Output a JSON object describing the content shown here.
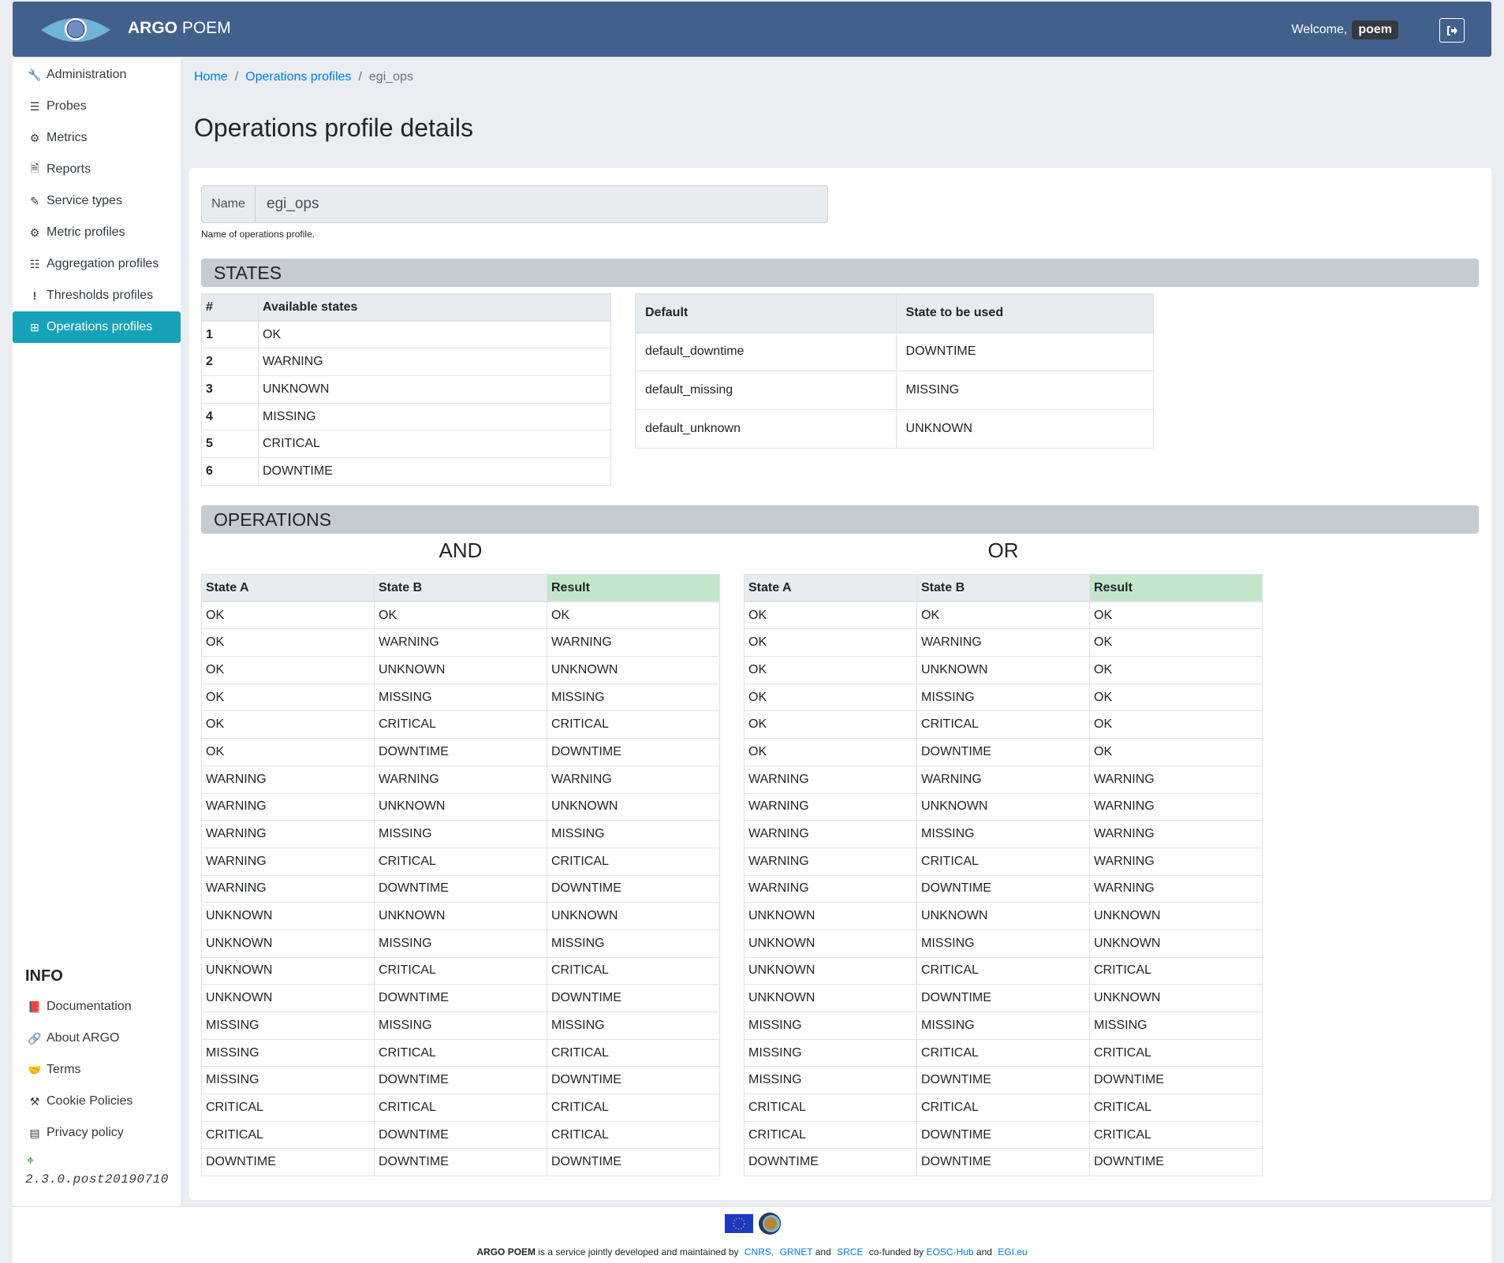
{
  "header": {
    "brand_bold": "ARGO",
    "brand_rest": "POEM",
    "welcome": "Welcome,",
    "username": "poem",
    "logout_icon": "sign-out-icon"
  },
  "sidebar": {
    "items": [
      {
        "label": "Administration",
        "icon": "wrench-icon"
      },
      {
        "label": "Probes",
        "icon": "server-icon"
      },
      {
        "label": "Metrics",
        "icon": "cog-icon"
      },
      {
        "label": "Reports",
        "icon": "file-icon"
      },
      {
        "label": "Service types",
        "icon": "highlighter-icon"
      },
      {
        "label": "Metric profiles",
        "icon": "cogs-icon"
      },
      {
        "label": "Aggregation profiles",
        "icon": "tasks-icon"
      },
      {
        "label": "Thresholds profiles",
        "icon": "exclamation-icon"
      },
      {
        "label": "Operations profiles",
        "icon": "table-icon",
        "active": true
      }
    ],
    "info_title": "INFO",
    "info_items": [
      {
        "label": "Documentation",
        "icon": "book-icon"
      },
      {
        "label": "About ARGO",
        "icon": "link-icon"
      },
      {
        "label": "Terms",
        "icon": "handshake-icon"
      },
      {
        "label": "Cookie Policies",
        "icon": "gavel-icon"
      },
      {
        "label": "Privacy policy",
        "icon": "id-card-icon"
      }
    ],
    "version": "2.3.0.post20190710"
  },
  "breadcrumb": [
    "Home",
    "Operations profiles",
    "egi_ops"
  ],
  "page_title": "Operations profile details",
  "form": {
    "name_label": "Name",
    "name_value": "egi_ops",
    "name_help": "Name of operations profile."
  },
  "states_section": {
    "title": "STATES",
    "available": {
      "headers": [
        "#",
        "Available states"
      ],
      "rows": [
        [
          "1",
          "OK"
        ],
        [
          "2",
          "WARNING"
        ],
        [
          "3",
          "UNKNOWN"
        ],
        [
          "4",
          "MISSING"
        ],
        [
          "5",
          "CRITICAL"
        ],
        [
          "6",
          "DOWNTIME"
        ]
      ]
    },
    "defaults": {
      "headers": [
        "Default",
        "State to be used"
      ],
      "rows": [
        [
          "default_downtime",
          "DOWNTIME"
        ],
        [
          "default_missing",
          "MISSING"
        ],
        [
          "default_unknown",
          "UNKNOWN"
        ]
      ]
    }
  },
  "operations_section": {
    "title": "OPERATIONS",
    "operations": [
      {
        "name": "AND",
        "headers": [
          "State A",
          "State B",
          "Result"
        ],
        "rows": [
          [
            "OK",
            "OK",
            "OK"
          ],
          [
            "OK",
            "WARNING",
            "WARNING"
          ],
          [
            "OK",
            "UNKNOWN",
            "UNKNOWN"
          ],
          [
            "OK",
            "MISSING",
            "MISSING"
          ],
          [
            "OK",
            "CRITICAL",
            "CRITICAL"
          ],
          [
            "OK",
            "DOWNTIME",
            "DOWNTIME"
          ],
          [
            "WARNING",
            "WARNING",
            "WARNING"
          ],
          [
            "WARNING",
            "UNKNOWN",
            "UNKNOWN"
          ],
          [
            "WARNING",
            "MISSING",
            "MISSING"
          ],
          [
            "WARNING",
            "CRITICAL",
            "CRITICAL"
          ],
          [
            "WARNING",
            "DOWNTIME",
            "DOWNTIME"
          ],
          [
            "UNKNOWN",
            "UNKNOWN",
            "UNKNOWN"
          ],
          [
            "UNKNOWN",
            "MISSING",
            "MISSING"
          ],
          [
            "UNKNOWN",
            "CRITICAL",
            "CRITICAL"
          ],
          [
            "UNKNOWN",
            "DOWNTIME",
            "DOWNTIME"
          ],
          [
            "MISSING",
            "MISSING",
            "MISSING"
          ],
          [
            "MISSING",
            "CRITICAL",
            "CRITICAL"
          ],
          [
            "MISSING",
            "DOWNTIME",
            "DOWNTIME"
          ],
          [
            "CRITICAL",
            "CRITICAL",
            "CRITICAL"
          ],
          [
            "CRITICAL",
            "DOWNTIME",
            "CRITICAL"
          ],
          [
            "DOWNTIME",
            "DOWNTIME",
            "DOWNTIME"
          ]
        ]
      },
      {
        "name": "OR",
        "headers": [
          "State A",
          "State B",
          "Result"
        ],
        "rows": [
          [
            "OK",
            "OK",
            "OK"
          ],
          [
            "OK",
            "WARNING",
            "OK"
          ],
          [
            "OK",
            "UNKNOWN",
            "OK"
          ],
          [
            "OK",
            "MISSING",
            "OK"
          ],
          [
            "OK",
            "CRITICAL",
            "OK"
          ],
          [
            "OK",
            "DOWNTIME",
            "OK"
          ],
          [
            "WARNING",
            "WARNING",
            "WARNING"
          ],
          [
            "WARNING",
            "UNKNOWN",
            "WARNING"
          ],
          [
            "WARNING",
            "MISSING",
            "WARNING"
          ],
          [
            "WARNING",
            "CRITICAL",
            "WARNING"
          ],
          [
            "WARNING",
            "DOWNTIME",
            "WARNING"
          ],
          [
            "UNKNOWN",
            "UNKNOWN",
            "UNKNOWN"
          ],
          [
            "UNKNOWN",
            "MISSING",
            "UNKNOWN"
          ],
          [
            "UNKNOWN",
            "CRITICAL",
            "CRITICAL"
          ],
          [
            "UNKNOWN",
            "DOWNTIME",
            "UNKNOWN"
          ],
          [
            "MISSING",
            "MISSING",
            "MISSING"
          ],
          [
            "MISSING",
            "CRITICAL",
            "CRITICAL"
          ],
          [
            "MISSING",
            "DOWNTIME",
            "DOWNTIME"
          ],
          [
            "CRITICAL",
            "CRITICAL",
            "CRITICAL"
          ],
          [
            "CRITICAL",
            "DOWNTIME",
            "CRITICAL"
          ],
          [
            "DOWNTIME",
            "DOWNTIME",
            "DOWNTIME"
          ]
        ]
      }
    ]
  },
  "footer": {
    "brand": "ARGO POEM",
    "text1": "is a service jointly developed and maintained by",
    "link_cnrs": "CNRS,",
    "link_grnet": "GRNET",
    "and1": "and",
    "link_srce": "SRCE",
    "text2": "co-funded by",
    "link_eosc": "EOSC-Hub",
    "and2": "and",
    "link_egi": "EGI.eu"
  },
  "colors": {
    "navbar": "#42608c",
    "active": "#17a2b8",
    "link": "#007bff",
    "section_head": "#c4cbd3",
    "result_header": "#c3e6cb"
  }
}
